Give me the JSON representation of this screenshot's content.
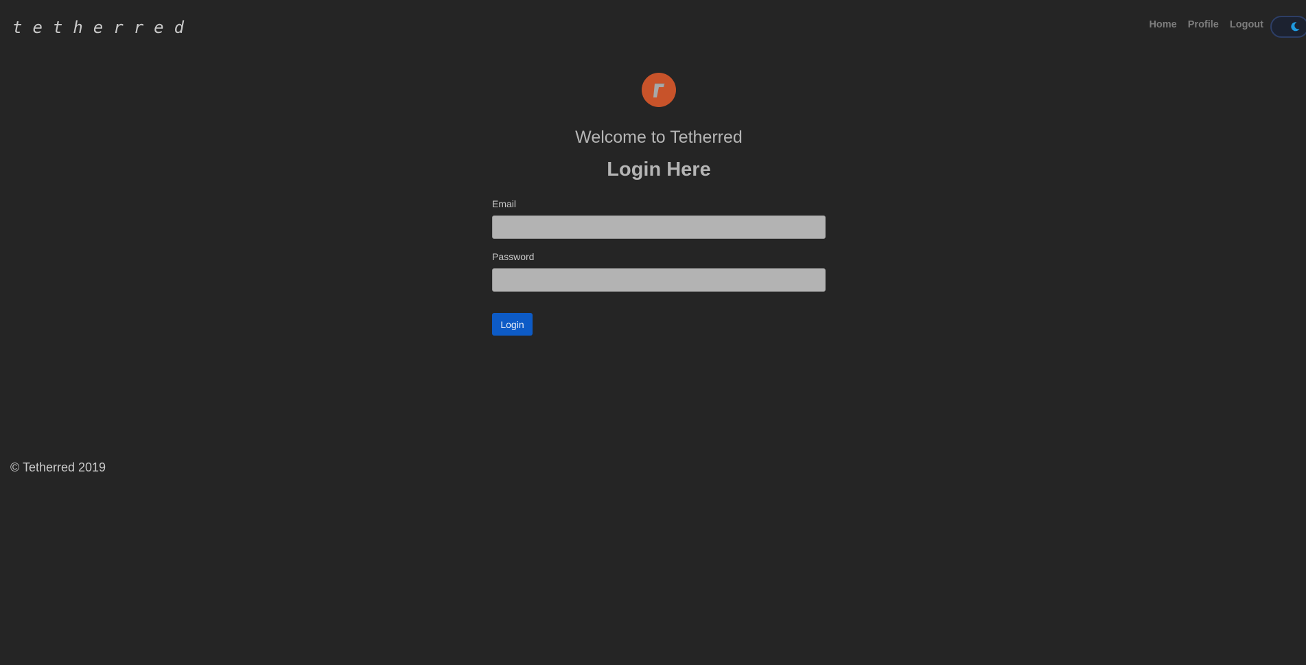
{
  "navbar": {
    "brand": "tetherred",
    "links": [
      {
        "label": "Home"
      },
      {
        "label": "Profile"
      },
      {
        "label": "Logout"
      }
    ],
    "theme_toggle_icon": "moon-icon"
  },
  "main": {
    "logo_icon": "tetherred-logo",
    "welcome": "Welcome to Tetherred",
    "heading": "Login Here",
    "email": {
      "label": "Email",
      "value": "",
      "placeholder": ""
    },
    "password": {
      "label": "Password",
      "value": "",
      "placeholder": ""
    },
    "login_button": "Login"
  },
  "footer": {
    "text": "© Tetherred 2019"
  },
  "colors": {
    "background": "#252525",
    "accent": "#c8532a",
    "button": "#0d5bc6",
    "toggle_moon": "#1f9ae0"
  }
}
